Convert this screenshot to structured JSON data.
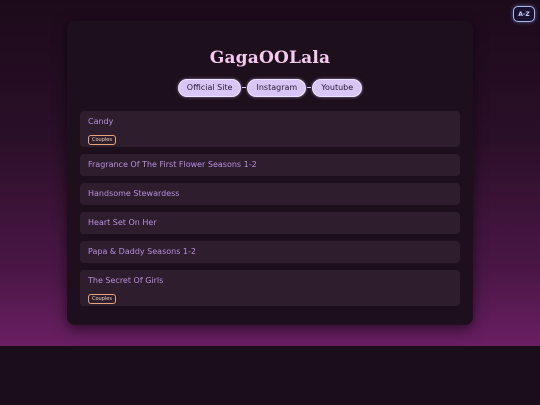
{
  "sort_button": {
    "label": "A-Z"
  },
  "page": {
    "title": "GagaOOLala"
  },
  "links": [
    {
      "label": "Official Site"
    },
    {
      "label": "Instagram"
    },
    {
      "label": "Youtube"
    }
  ],
  "items": [
    {
      "title": "Candy",
      "tag": "Couples"
    },
    {
      "title": "Fragrance Of The First Flower Seasons 1-2"
    },
    {
      "title": "Handsome Stewardess"
    },
    {
      "title": "Heart Set On Her"
    },
    {
      "title": "Papa & Daddy Seasons 1-2"
    },
    {
      "title": "The Secret Of Girls",
      "tag": "Couples"
    }
  ]
}
